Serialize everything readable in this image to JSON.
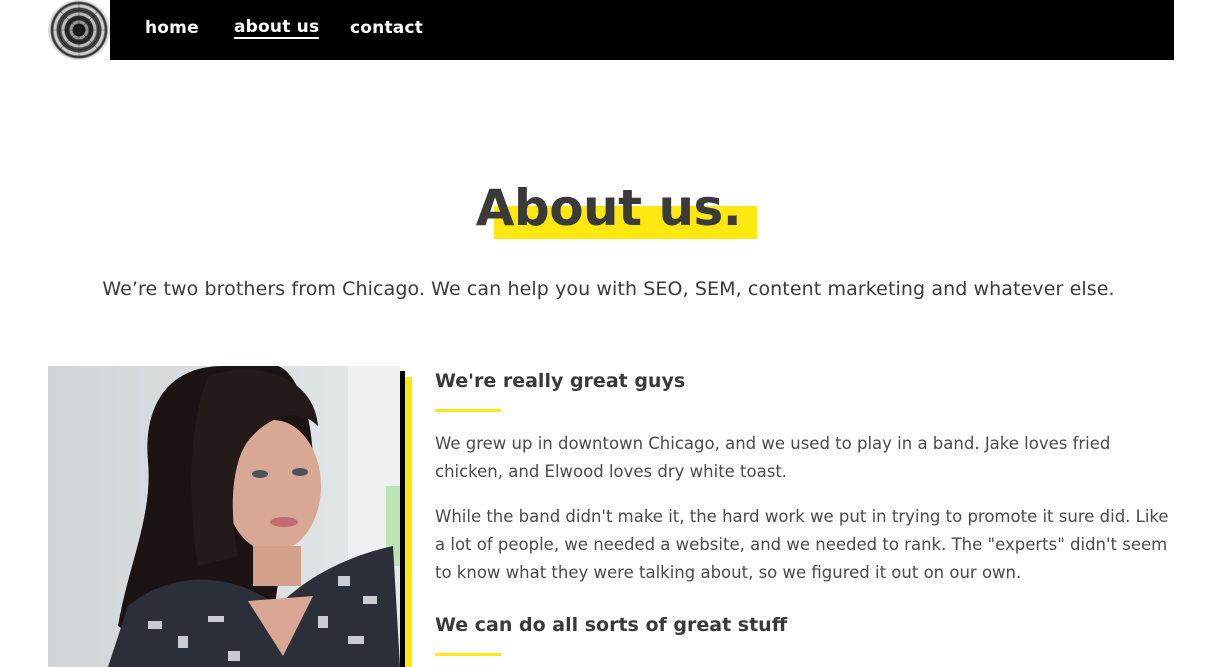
{
  "nav": {
    "items": [
      {
        "label": "home"
      },
      {
        "label": "about us"
      },
      {
        "label": "contact"
      }
    ],
    "active": "about us"
  },
  "hero": {
    "title": "About us.",
    "subtitle": "We’re two brothers from Chicago. We can help you with SEO, SEM, content marketing and whatever else."
  },
  "sections": [
    {
      "heading": "We're really great guys",
      "paragraphs": [
        "We grew up in downtown Chicago, and we used to play in a band. Jake loves fried chicken, and Elwood loves dry white toast.",
        "While the band didn't make it, the hard work we put in trying to promote it sure did. Like a lot of people, we needed a website, and we needed to rank. The \"experts\" didn't seem to know what they were talking about, so we figured it out on our own."
      ]
    },
    {
      "heading": "We can do all sorts of great stuff"
    }
  ],
  "colors": {
    "accent": "#ffe812",
    "nav_bg": "#000000",
    "text": "#3a3a3a"
  },
  "icons": {
    "logo": "mandala-logo-icon"
  }
}
